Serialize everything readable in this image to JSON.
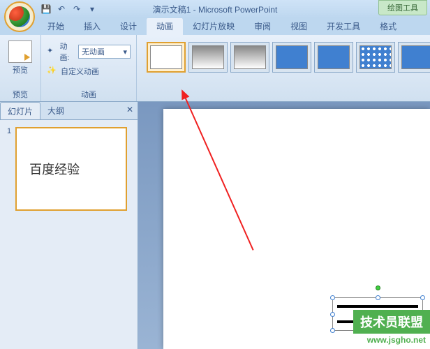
{
  "titlebar": {
    "title": "演示文稿1 - Microsoft PowerPoint",
    "contextual": "绘图工具"
  },
  "tabs": {
    "home": "开始",
    "insert": "插入",
    "design": "设计",
    "animation": "动画",
    "slideshow": "幻灯片放映",
    "review": "审阅",
    "view": "视图",
    "developer": "开发工具",
    "format": "格式"
  },
  "ribbon": {
    "preview": "预览",
    "preview_group": "预览",
    "anim_label": "动画:",
    "anim_value": "无动画",
    "custom_anim": "自定义动画",
    "anim_group": "动画"
  },
  "panel": {
    "slides_tab": "幻灯片",
    "outline_tab": "大纲",
    "thumb_num": "1",
    "thumb_text": "百度经验"
  },
  "watermark": {
    "text": "技术员联盟",
    "url": "www.jsgho.net"
  }
}
